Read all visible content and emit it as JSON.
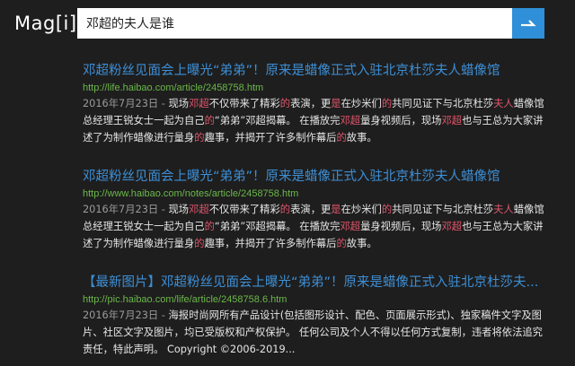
{
  "app": {
    "logo": "Mag[i]"
  },
  "search": {
    "query": "邓超的夫人是谁"
  },
  "colors": {
    "accent": "#2f8fd8",
    "link": "#3d8fd6",
    "url": "#6bb84a",
    "highlight": "#e0556a",
    "background": "#1e1e1e"
  },
  "results": [
    {
      "title": "邓超粉丝见面会上曝光“弟弟”！原来是蜡像正式入驻北京杜莎夫人蜡像馆",
      "url": "http://life.haibao.com/article/2458758.htm",
      "snippet": [
        {
          "t": "2016年7月23日 - ",
          "c": "date"
        },
        {
          "t": "现场"
        },
        {
          "t": "邓超",
          "c": "hl"
        },
        {
          "t": "不仅带来了精彩"
        },
        {
          "t": "的",
          "c": "hl"
        },
        {
          "t": "表演，更"
        },
        {
          "t": "是",
          "c": "hl"
        },
        {
          "t": "在炒米们"
        },
        {
          "t": "的",
          "c": "hl"
        },
        {
          "t": "共同见证下与北京杜莎"
        },
        {
          "t": "夫人",
          "c": "hl"
        },
        {
          "t": "蜡像馆总经理王锐女士一起为自己"
        },
        {
          "t": "的",
          "c": "hl"
        },
        {
          "t": "“弟弟”邓超揭幕。 在播放完"
        },
        {
          "t": "邓超",
          "c": "hl"
        },
        {
          "t": "量身视频后，现场"
        },
        {
          "t": "邓超",
          "c": "hl"
        },
        {
          "t": "也与王总为大家讲述了为制作蜡像进行量身"
        },
        {
          "t": "的",
          "c": "hl"
        },
        {
          "t": "趣事，并揭开了许多制作幕后"
        },
        {
          "t": "的",
          "c": "hl"
        },
        {
          "t": "故事。"
        }
      ]
    },
    {
      "title": "邓超粉丝见面会上曝光“弟弟”！原来是蜡像正式入驻北京杜莎夫人蜡像馆",
      "url": "http://www.haibao.com/notes/article/2458758.htm",
      "snippet": [
        {
          "t": "2016年7月23日 - ",
          "c": "date"
        },
        {
          "t": "现场"
        },
        {
          "t": "邓超",
          "c": "hl"
        },
        {
          "t": "不仅带来了精彩"
        },
        {
          "t": "的",
          "c": "hl"
        },
        {
          "t": "表演，更"
        },
        {
          "t": "是",
          "c": "hl"
        },
        {
          "t": "在炒米们"
        },
        {
          "t": "的",
          "c": "hl"
        },
        {
          "t": "共同见证下与北京杜莎"
        },
        {
          "t": "夫人",
          "c": "hl"
        },
        {
          "t": "蜡像馆总经理王锐女士一起为自己"
        },
        {
          "t": "的",
          "c": "hl"
        },
        {
          "t": "“弟弟”邓超揭幕。 在播放完"
        },
        {
          "t": "邓超",
          "c": "hl"
        },
        {
          "t": "量身视频后，现场"
        },
        {
          "t": "邓超",
          "c": "hl"
        },
        {
          "t": "也与王总为大家讲述了为制作蜡像进行量身"
        },
        {
          "t": "的",
          "c": "hl"
        },
        {
          "t": "趣事，并揭开了许多制作幕后"
        },
        {
          "t": "的",
          "c": "hl"
        },
        {
          "t": "故事。"
        }
      ]
    },
    {
      "title": "【最新图片】邓超粉丝见面会上曝光“弟弟”！原来是蜡像正式入驻北京杜莎夫...",
      "url": "http://pic.haibao.com/life/article/2458758.6.htm",
      "snippet": [
        {
          "t": "2016年7月23日 - ",
          "c": "date"
        },
        {
          "t": "海报时尚网所有产品设计(包括图形设计、配色、页面展示形式)、独家稿件文字及图片、社区文字及图片，均已受版权和产权保护。 任何公司及个人不得以任何方式复制，违者将依法追究责任，特此声明。 Copyright ©2006-2019..."
        }
      ]
    }
  ]
}
